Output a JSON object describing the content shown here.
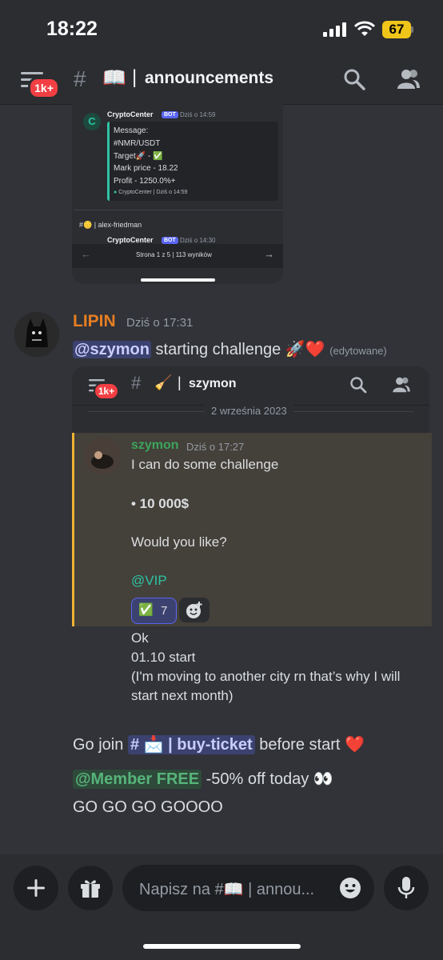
{
  "status_bar": {
    "time": "18:22",
    "battery": "67"
  },
  "header": {
    "unread_badge": "1k+",
    "channel_icon": "📖",
    "channel_name": "announcements",
    "separator": "|"
  },
  "top_embed": {
    "bot_name": "CryptoCenter",
    "bot_tag": "BOT",
    "time": "Dziś o 14:59",
    "embed_lines": [
      "Message:",
      "#NMR/USDT",
      "Target🚀 - ✅",
      "Mark price - 18.22",
      "Profit - 1250.0%+"
    ],
    "footer": "CryptoCenter | Dziś o 14:59",
    "next_channel": "#🪙 | alex-friedman",
    "next_bot": "CryptoCenter",
    "next_time": "Dziś o 14:30",
    "pager_text": "Strona 1 z 5",
    "pager_sep": "|",
    "pager_results": "113 wyników"
  },
  "message": {
    "author": "LIPIN",
    "time": "Dziś o 17:31",
    "mention": "@szymon",
    "text": " starting challenge 🚀❤️ ",
    "edited": "(edytowane)"
  },
  "inner_shot": {
    "unread_badge": "1k+",
    "channel_icon": "🧹",
    "channel_name": "szymon",
    "date_divider": "2 września 2023",
    "author": "szymon",
    "time": "Dziś o 17:27",
    "line1": "I can do some challenge",
    "line2": "• 10 000$",
    "line3": "Would you like?",
    "line4": "@VIP",
    "reaction_emoji": "✅",
    "reaction_count": "7",
    "after_lines": [
      "Ok",
      "01.10 start",
      "(I'm moving to another city rn that’s why I will",
      "start next month)"
    ]
  },
  "message_lines": {
    "go_join": "Go join ",
    "channel_mention": "# 📩 | buy-ticket",
    "before_start": " before  start ❤️",
    "role_mention": "@Member FREE",
    "discount": " -50% off today 👀",
    "go_go": "GO GO GO GOOOO"
  },
  "composer": {
    "placeholder": "Napisz na #📖 | annou..."
  }
}
